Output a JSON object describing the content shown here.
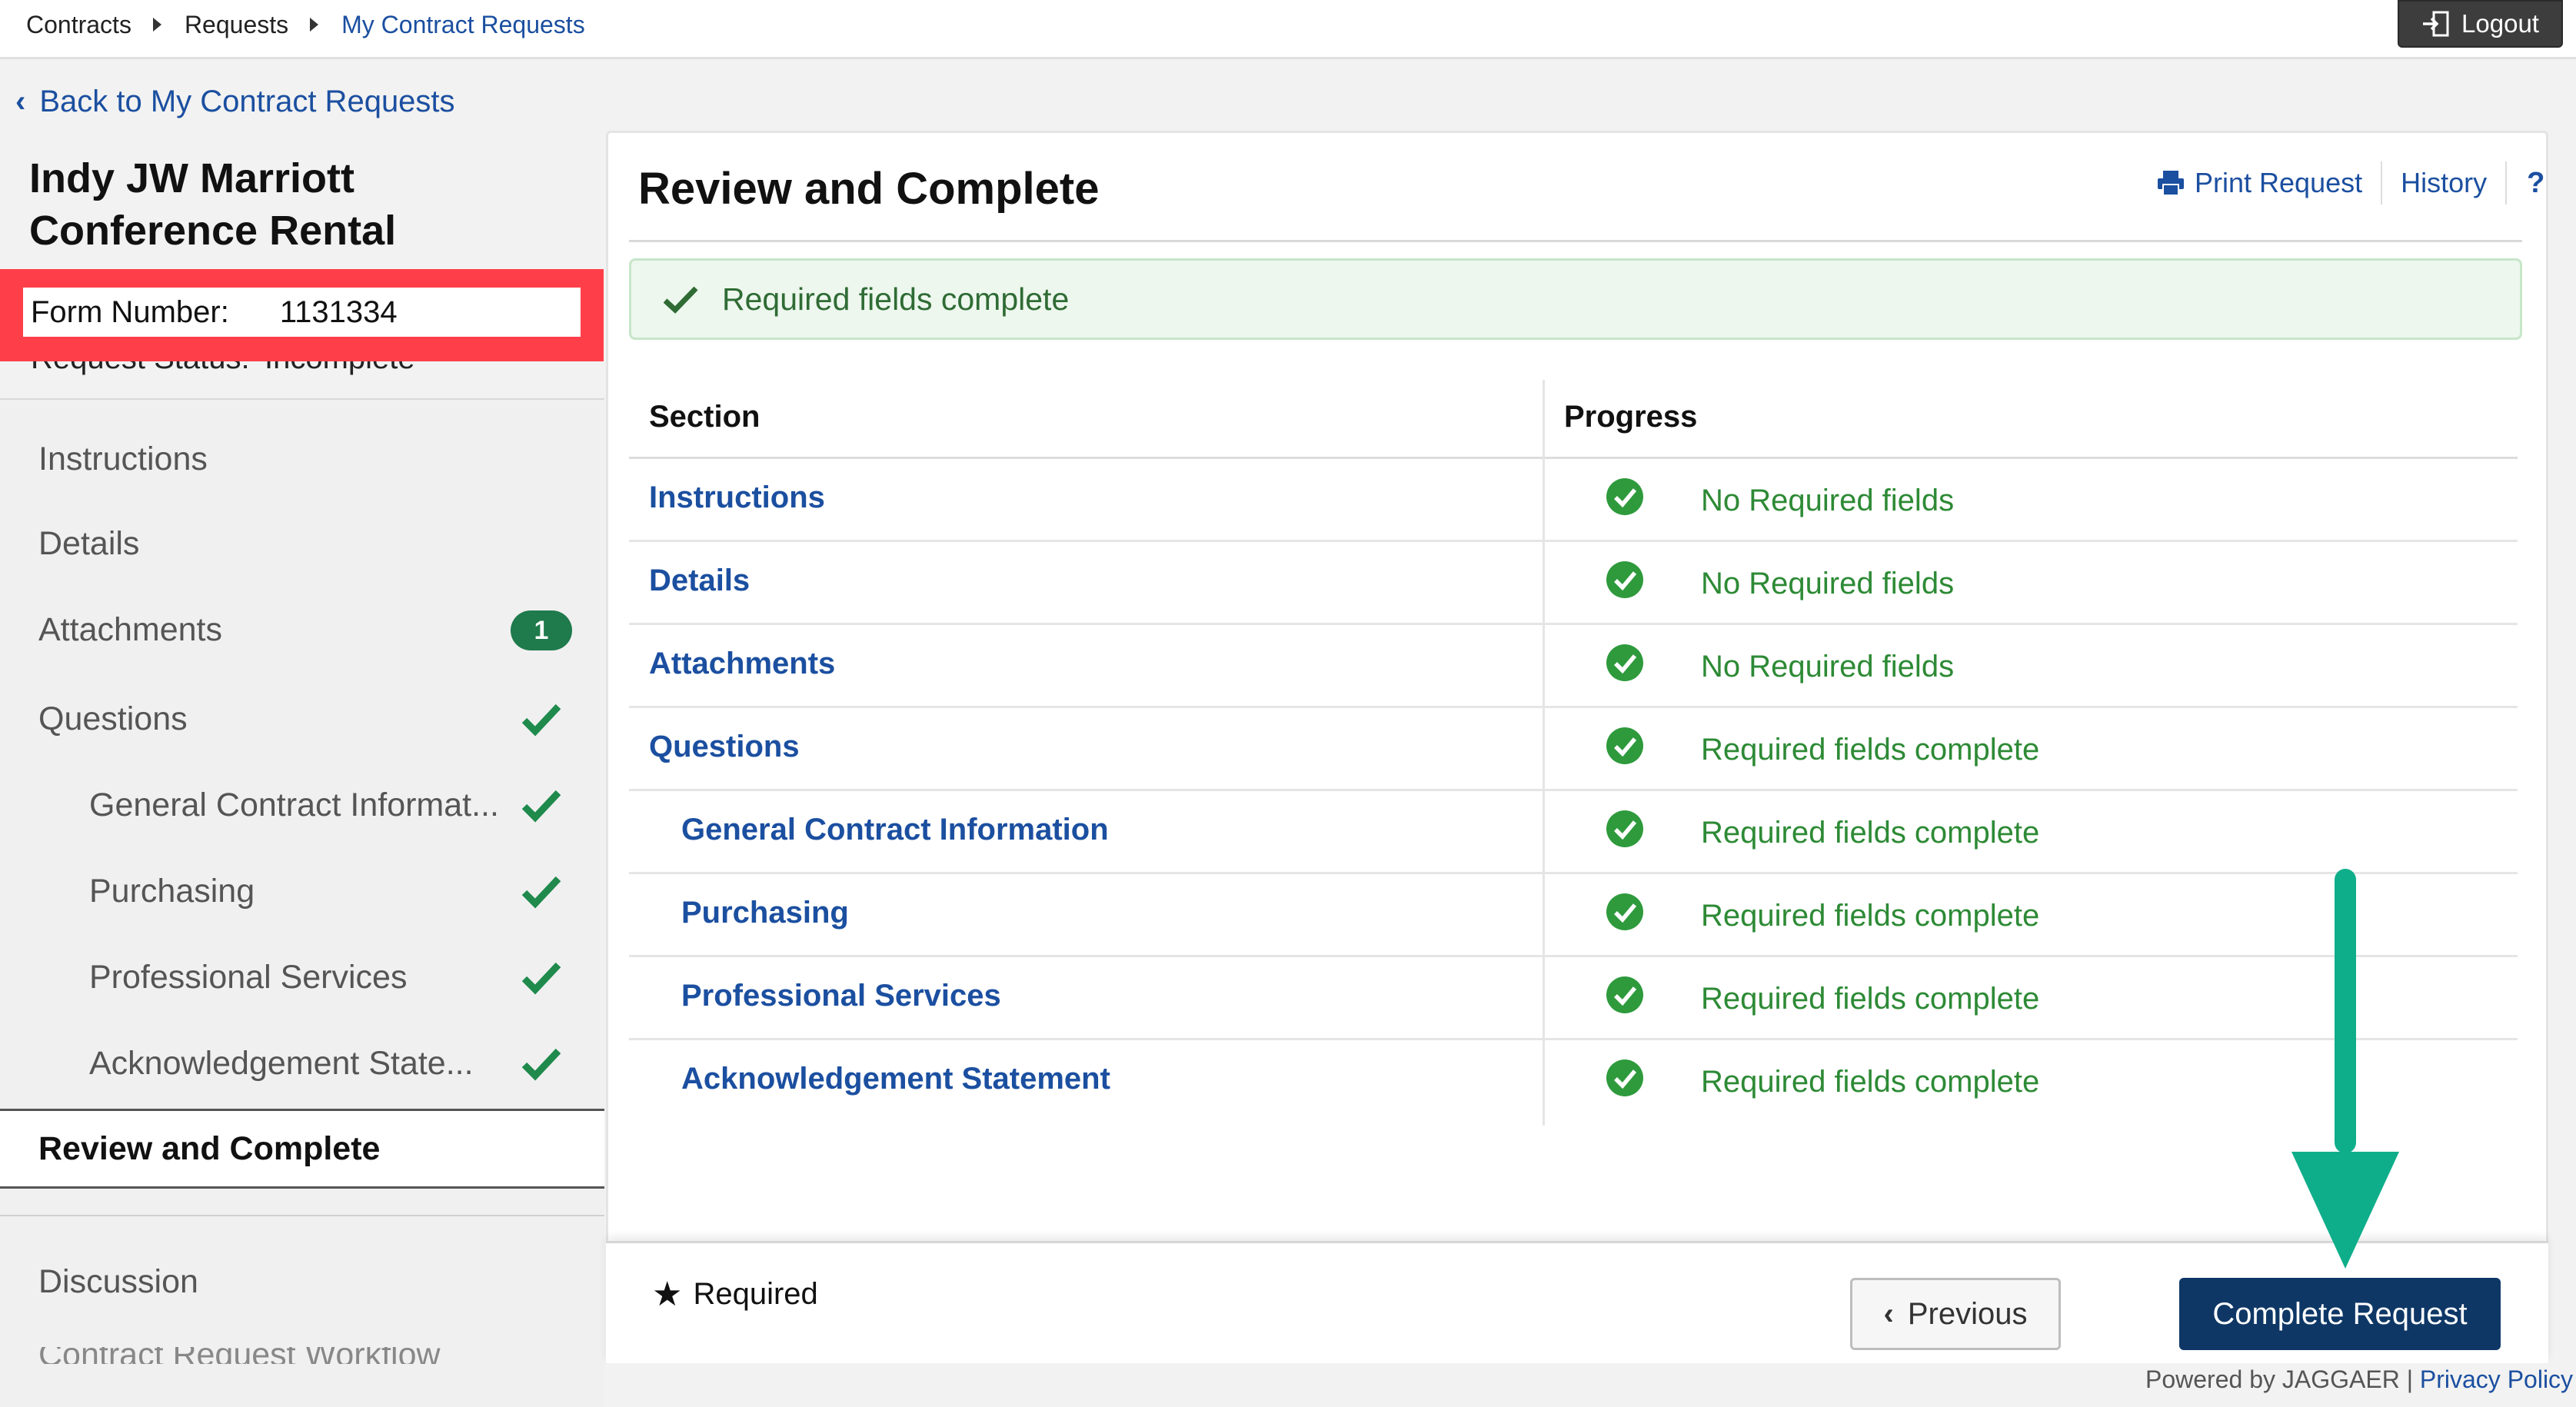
{
  "breadcrumb": [
    "Contracts",
    "Requests",
    "My Contract Requests"
  ],
  "logout_label": "Logout",
  "back_label": "Back to My Contract Requests",
  "request": {
    "title_line1": "Indy JW Marriott",
    "title_line2": "Conference Rental",
    "form_number_label": "Form Number:",
    "form_number_value": "1131334",
    "status_label": "Request Status:",
    "status_value": "Incomplete"
  },
  "nav": {
    "items": [
      {
        "label": "Instructions"
      },
      {
        "label": "Details"
      },
      {
        "label": "Attachments",
        "badge": "1"
      },
      {
        "label": "Questions"
      },
      {
        "label": "General Contract Informat..."
      },
      {
        "label": "Purchasing"
      },
      {
        "label": "Professional Services"
      },
      {
        "label": "Acknowledgement State..."
      },
      {
        "label": "Review and Complete"
      },
      {
        "label": "Discussion"
      }
    ],
    "cut_item": "Contract Request Workflow"
  },
  "panel": {
    "title": "Review and Complete",
    "print_label": "Print Request",
    "history_label": "History",
    "help_label": "?",
    "alert_text": "Required fields complete",
    "col_section": "Section",
    "col_progress": "Progress",
    "rows": [
      {
        "section": "Instructions",
        "progress": "No Required fields"
      },
      {
        "section": "Details",
        "progress": "No Required fields"
      },
      {
        "section": "Attachments",
        "progress": "No Required fields"
      },
      {
        "section": "Questions",
        "progress": "Required fields complete"
      },
      {
        "section": "General Contract Information",
        "progress": "Required fields complete"
      },
      {
        "section": "Purchasing",
        "progress": "Required fields complete"
      },
      {
        "section": "Professional Services",
        "progress": "Required fields complete"
      },
      {
        "section": "Acknowledgement Statement",
        "progress": "Required fields complete"
      }
    ]
  },
  "footer": {
    "required_note": "Required",
    "previous_label": "Previous",
    "complete_label": "Complete Request",
    "powered_by": "Powered by JAGGAER |",
    "privacy": "Privacy Policy"
  },
  "colors": {
    "link": "#1b4fa0",
    "success": "#2d8a35",
    "primary_button": "#0e3766",
    "highlight_box": "#fe3f49",
    "annotation_arrow": "#0fae8a"
  }
}
